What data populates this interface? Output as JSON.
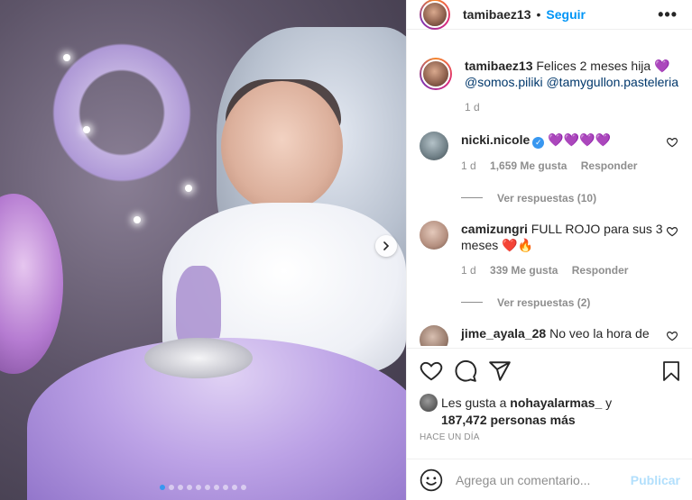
{
  "post": {
    "username": "tamibaez13",
    "follow_label": "Seguir",
    "more_label": "•••",
    "separator": "•"
  },
  "caption": {
    "username": "tamibaez13",
    "text": "Felices 2 meses hija",
    "emoji": "💜",
    "mentions": [
      "@somos.piliki",
      "@tamygullon.pasteleria"
    ],
    "time": "1 d"
  },
  "comments": [
    {
      "username": "nicki.nicole",
      "verified": true,
      "text": "",
      "emoji": "💜💜💜💜",
      "time": "1 d",
      "likes": "1,659 Me gusta",
      "reply_label": "Responder",
      "view_replies": "Ver respuestas (10)",
      "avatar_color": "#6f7f86"
    },
    {
      "username": "camizungri",
      "verified": false,
      "text": "FULL ROJO para sus 3 meses",
      "emoji": "❤️🔥",
      "time": "1 d",
      "likes": "339 Me gusta",
      "reply_label": "Responder",
      "view_replies": "Ver respuestas (2)",
      "avatar_color": "#b48f7f"
    },
    {
      "username": "jime_ayala_28",
      "verified": false,
      "text": "No veo la hora de",
      "emoji": "",
      "avatar_color": "#9a7d6e"
    }
  ],
  "actions": {
    "like_icon": "heart-icon",
    "comment_icon": "comment-icon",
    "share_icon": "share-icon",
    "save_icon": "bookmark-icon"
  },
  "likes": {
    "prefix": "Les gusta a",
    "first_liker": "nohayalarmas_",
    "conjunction": "y",
    "others": "187,472 personas más"
  },
  "posted": "Hace un día",
  "add_comment": {
    "placeholder": "Agrega un comentario...",
    "publish_label": "Publicar"
  },
  "carousel": {
    "total": 10,
    "active_index": 0
  },
  "colors": {
    "link_blue": "#0095f6",
    "mention_blue": "#00376b",
    "muted_gray": "#8e8e8e",
    "publish_disabled": "#b2dffc",
    "verified_blue": "#3897f0"
  }
}
